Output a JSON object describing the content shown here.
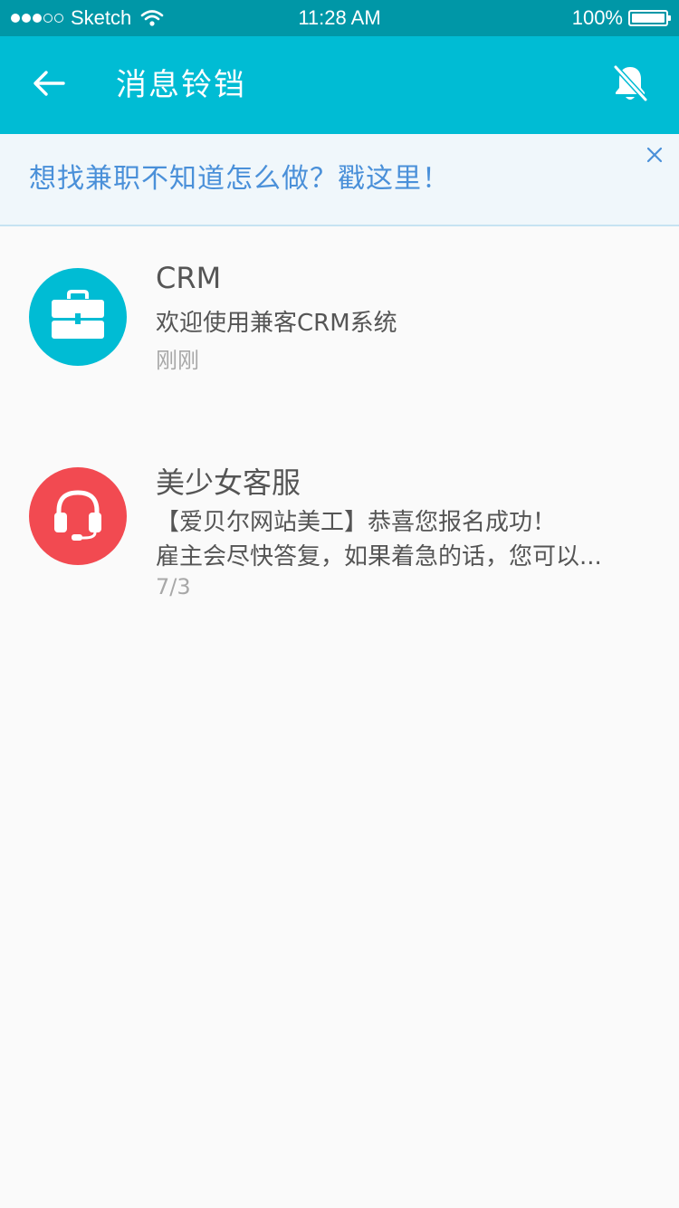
{
  "status_bar": {
    "carrier": "Sketch",
    "time": "11:28 AM",
    "battery": "100%"
  },
  "app_bar": {
    "title": "消息铃铛",
    "back_icon": "arrow-left-icon",
    "mute_icon": "bell-off-icon"
  },
  "banner": {
    "text": "想找兼职不知道怎么做？戳这里！",
    "close_icon": "close-icon"
  },
  "messages": [
    {
      "name": "CRM",
      "lines": [
        "欢迎使用兼客CRM系统"
      ],
      "time": "刚刚",
      "avatar_icon": "briefcase-icon",
      "avatar_color": "#00bcd4"
    },
    {
      "name": "美少女客服",
      "lines": [
        "【爱贝尔网站美工】恭喜您报名成功！",
        "雇主会尽快答复，如果着急的话，您可以..."
      ],
      "time": "7/3",
      "avatar_icon": "headset-icon",
      "avatar_color": "#f24a51"
    }
  ],
  "colors": {
    "status_bar": "#0097a7",
    "app_bar": "#00bcd4",
    "banner_text": "#4a90d9",
    "banner_bg": "#f0f7fb"
  }
}
